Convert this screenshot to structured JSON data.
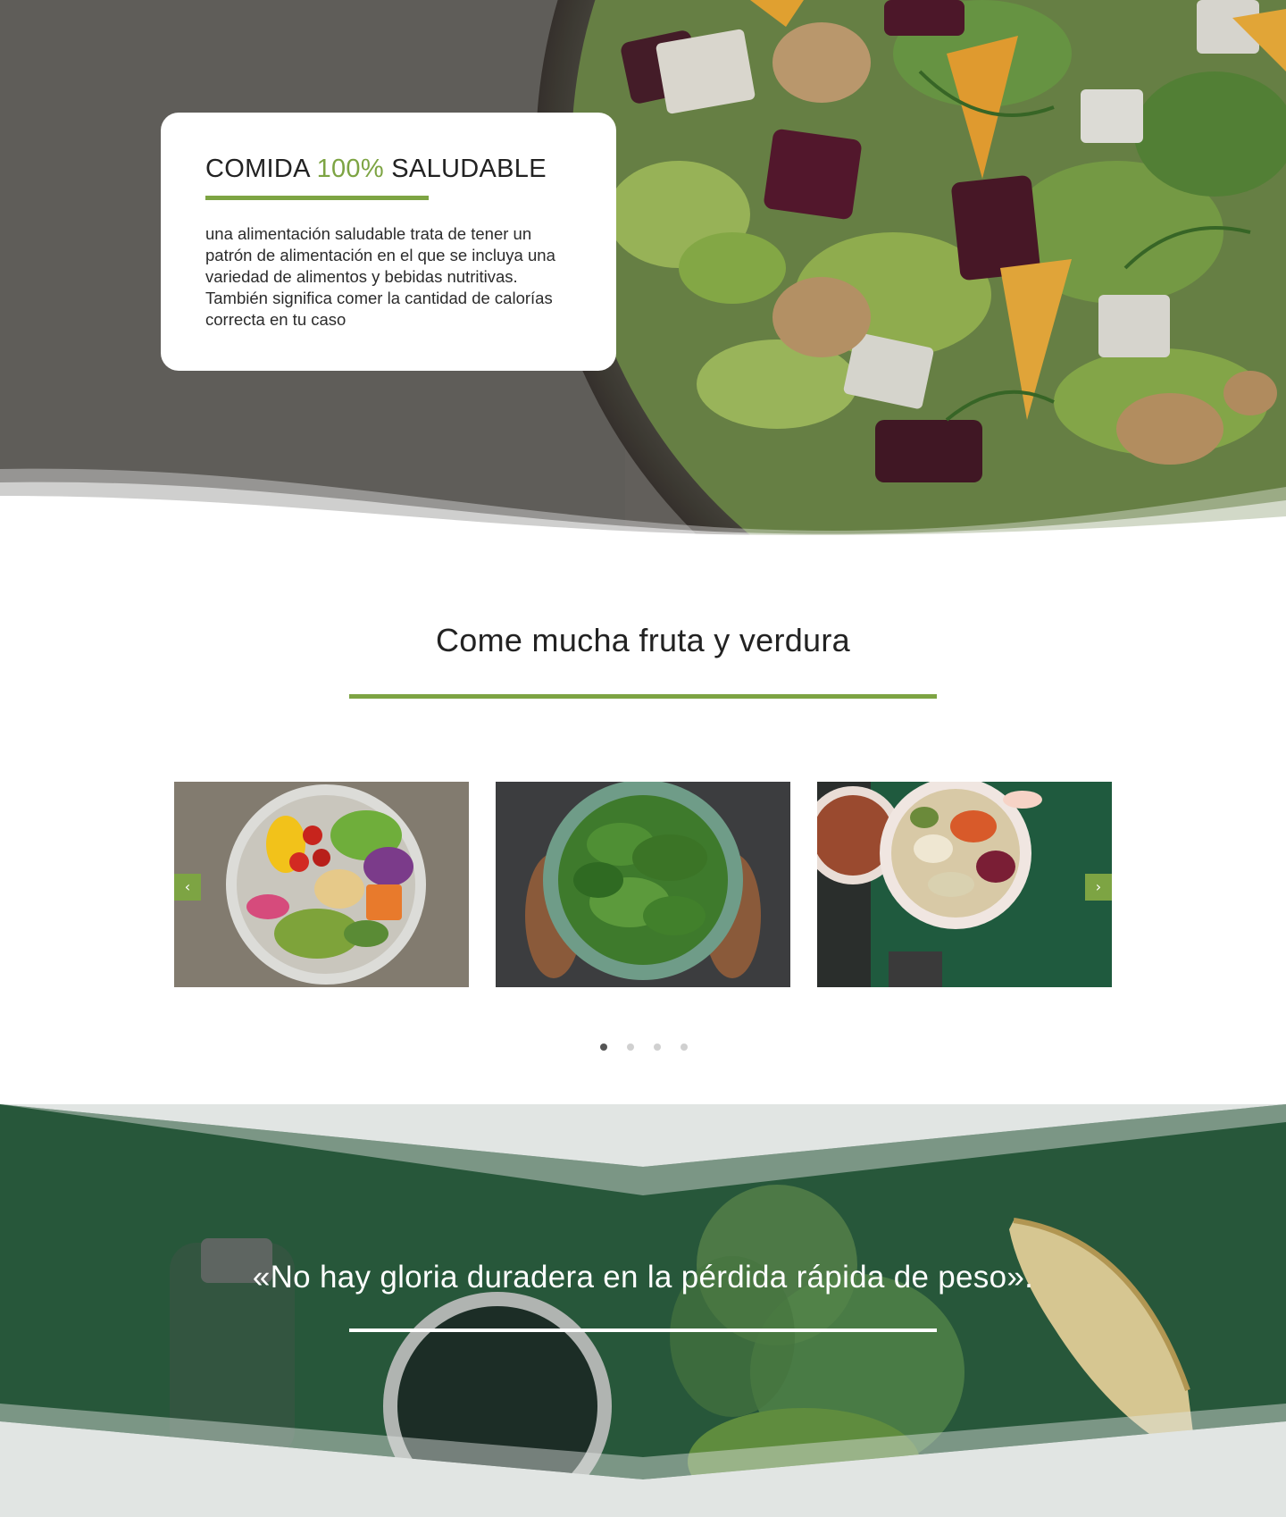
{
  "hero": {
    "title_prefix": "COMIDA ",
    "title_accent": "100%",
    "title_suffix": " SALUDABLE",
    "body": "una alimentación saludable trata de tener un patrón de alimentación en el que se incluya una variedad de alimentos y bebidas nutritivas. También significa comer la cantidad de calorías correcta en tu caso"
  },
  "produce": {
    "title": "Come mucha fruta y verdura",
    "prev_label": "‹",
    "next_label": "›",
    "slides": [
      {
        "image": "vegetable-bowl-on-wood"
      },
      {
        "image": "spinach-bowl-in-hands"
      },
      {
        "image": "grain-bowls-on-green"
      }
    ],
    "dots": {
      "count": 4,
      "active": 0
    }
  },
  "quote": {
    "text": "«No hay gloria duradera en la pérdida rápida de peso»."
  },
  "colors": {
    "accent": "#7da443",
    "dark_green": "#2c5e3f",
    "white": "#ffffff"
  }
}
